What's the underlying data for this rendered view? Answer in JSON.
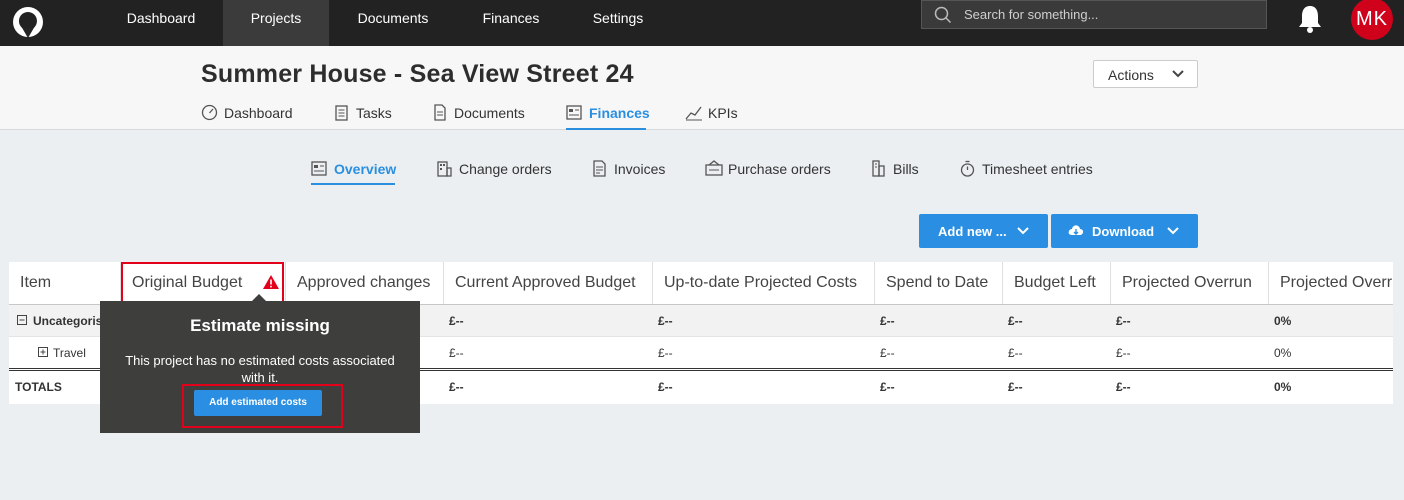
{
  "topnav": {
    "items": [
      "Dashboard",
      "Projects",
      "Documents",
      "Finances",
      "Settings"
    ],
    "active": "Projects",
    "search_placeholder": "Search for something...",
    "avatar_initials": "MK"
  },
  "project": {
    "title": "Summer House - Sea View Street 24",
    "actions_label": "Actions",
    "tabs": [
      "Dashboard",
      "Tasks",
      "Documents",
      "Finances",
      "KPIs"
    ],
    "active_tab": "Finances"
  },
  "finances": {
    "subtabs": [
      "Overview",
      "Change orders",
      "Invoices",
      "Purchase orders",
      "Bills",
      "Timesheet entries"
    ],
    "active_subtab": "Overview",
    "add_new_label": "Add new ...",
    "download_label": "Download"
  },
  "table": {
    "columns": [
      "Item",
      "Original Budget",
      "Approved changes",
      "Current Approved Budget",
      "Up-to-date Projected Costs",
      "Spend to Date",
      "Budget Left",
      "Projected Overrun",
      "Projected Overr"
    ],
    "rows": [
      {
        "item": "Uncategorised",
        "current_approved": "£--",
        "projected_costs": "£--",
        "spend": "£--",
        "left": "£--",
        "overrun": "£--",
        "overrun_pct": "0%"
      },
      {
        "item": "Travel",
        "current_approved": "£--",
        "projected_costs": "£--",
        "spend": "£--",
        "left": "£--",
        "overrun": "£--",
        "overrun_pct": "0%"
      }
    ],
    "totals": {
      "item": "TOTALS",
      "current_approved": "£--",
      "projected_costs": "£--",
      "spend": "£--",
      "left": "£--",
      "overrun": "£--",
      "overrun_pct": "0%"
    }
  },
  "tooltip": {
    "title": "Estimate missing",
    "body": "This project has no estimated costs associated with it.",
    "button_label": "Add estimated costs"
  },
  "colors": {
    "accent": "#2a8fe2",
    "highlight": "#e3001b",
    "topbar": "#222222"
  }
}
